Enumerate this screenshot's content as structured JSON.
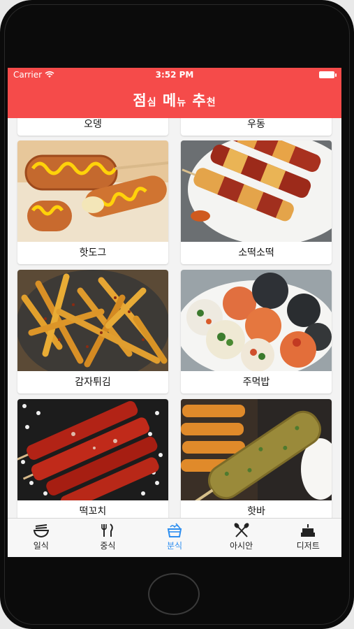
{
  "status": {
    "carrier": "Carrier",
    "time": "3:52 PM"
  },
  "header": {
    "title_big1": "점",
    "title_small1": "심",
    "title_big2": "메",
    "title_small2": "뉴",
    "title_big3": "추",
    "title_small3": "천"
  },
  "menu": {
    "partial": [
      "오뎅",
      "우동"
    ],
    "items": [
      "핫도그",
      "소떡소떡",
      "감자튀김",
      "주먹밥",
      "떡꼬치",
      "핫바"
    ]
  },
  "tabs": [
    "일식",
    "중식",
    "분식",
    "아시안",
    "디저트"
  ],
  "active_tab": "분식",
  "colors": {
    "header": "#f54b4a",
    "active": "#2d8ef0"
  }
}
